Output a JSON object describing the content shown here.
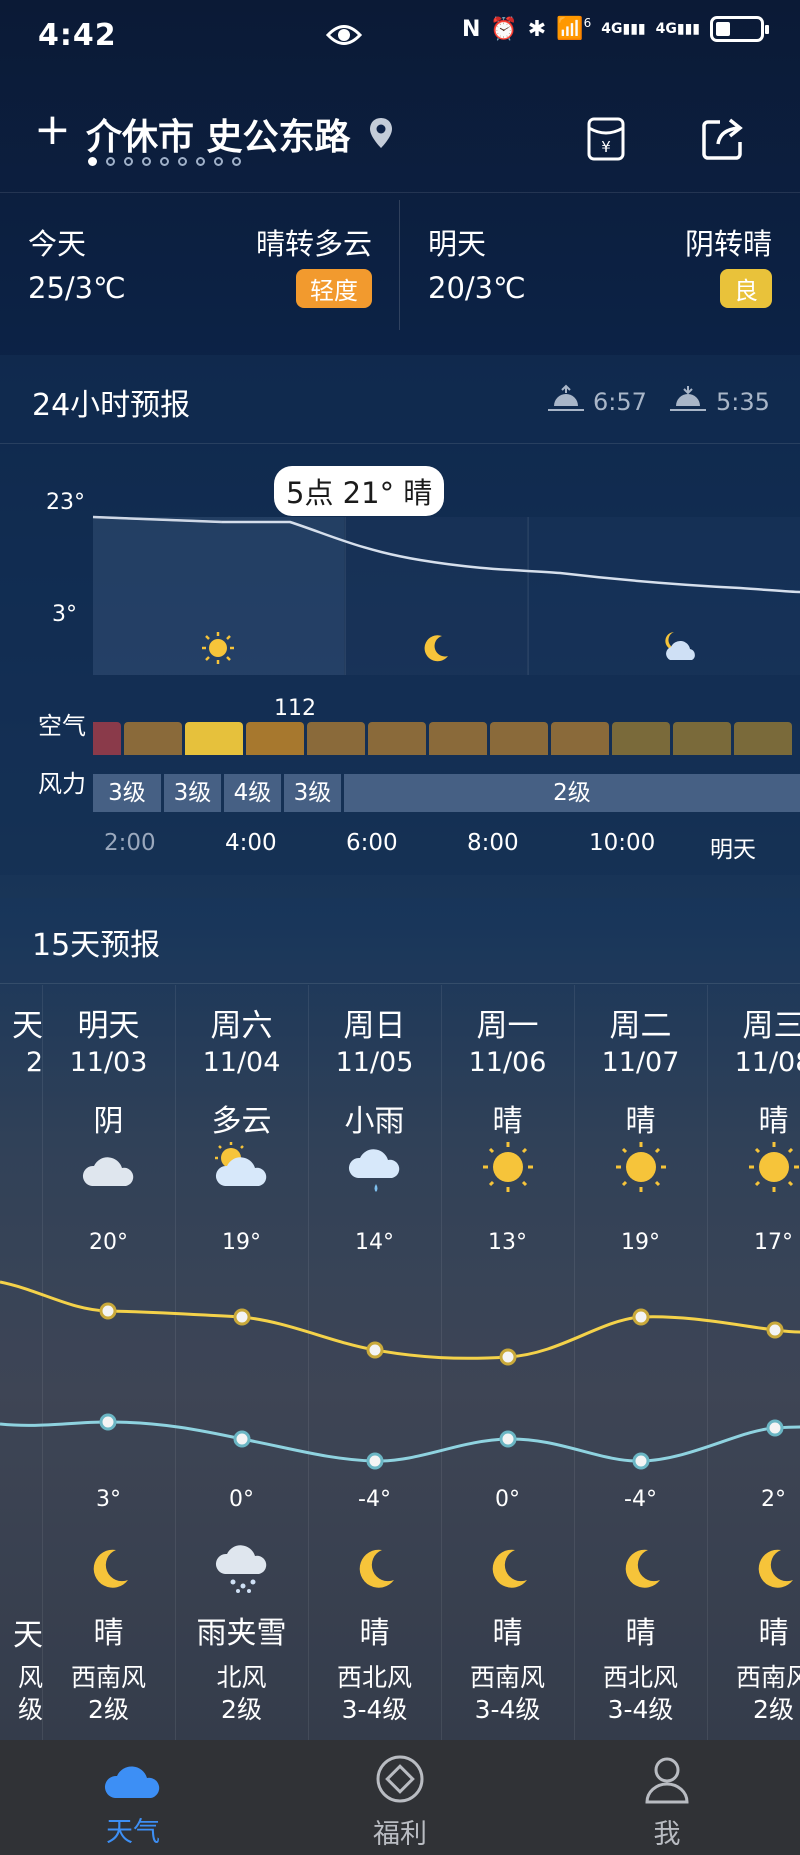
{
  "status_bar": {
    "time": "4:42",
    "net1": "4G",
    "net2": "4G",
    "wifi_badge": "6"
  },
  "header": {
    "add_label": "+",
    "location": "介休市 史公东路",
    "page_count": 9,
    "active_page": 0
  },
  "summary": {
    "today": {
      "label": "今天",
      "temp": "25/3℃",
      "condition": "晴转多云",
      "aq": "轻度",
      "aq_color": "#f29a2e"
    },
    "tomorrow": {
      "label": "明天",
      "temp": "20/3℃",
      "condition": "阴转晴",
      "aq": "良",
      "aq_color": "#e9c23a"
    }
  },
  "forecast_24h": {
    "title": "24小时预报",
    "sunrise": "6:57",
    "sunset": "5:35",
    "y_max_label": "23°",
    "y_min_label": "3°",
    "tooltip": "5点 21° 晴",
    "air_label": "空气",
    "air_value_label": "112",
    "wind_label": "风力",
    "wind_cells": [
      "3级",
      "3级",
      "4级",
      "3级",
      "2级"
    ],
    "time_labels": [
      "2:00",
      "4:00",
      "6:00",
      "8:00",
      "10:00",
      "明天"
    ],
    "aqi_colors": [
      "#8a3a4a",
      "#8a6a3a",
      "#e6c13c",
      "#a7782e",
      "#8a6a3a",
      "#8a6a3a",
      "#8a6a3a",
      "#8a6a3a",
      "#8a6a3a",
      "#7a6a3a",
      "#7a6a3a",
      "#7a6a3a"
    ]
  },
  "forecast_15d": {
    "title": "15天预报",
    "days": [
      {
        "name": "天",
        "date": "2",
        "day_cond": "",
        "high": "",
        "low": "",
        "night_cond": "天",
        "wind_dir": "风",
        "wind_level": "级"
      },
      {
        "name": "明天",
        "date": "11/03",
        "day_cond": "阴",
        "high": "20°",
        "low": "3°",
        "night_cond": "晴",
        "wind_dir": "西南风",
        "wind_level": "2级"
      },
      {
        "name": "周六",
        "date": "11/04",
        "day_cond": "多云",
        "high": "19°",
        "low": "0°",
        "night_cond": "雨夹雪",
        "wind_dir": "北风",
        "wind_level": "2级"
      },
      {
        "name": "周日",
        "date": "11/05",
        "day_cond": "小雨",
        "high": "14°",
        "low": "-4°",
        "night_cond": "晴",
        "wind_dir": "西北风",
        "wind_level": "3-4级"
      },
      {
        "name": "周一",
        "date": "11/06",
        "day_cond": "晴",
        "high": "13°",
        "low": "0°",
        "night_cond": "晴",
        "wind_dir": "西南风",
        "wind_level": "3-4级"
      },
      {
        "name": "周二",
        "date": "11/07",
        "day_cond": "晴",
        "high": "19°",
        "low": "-4°",
        "night_cond": "晴",
        "wind_dir": "西北风",
        "wind_level": "3-4级"
      },
      {
        "name": "周三",
        "date": "11/08",
        "day_cond": "晴",
        "high": "17°",
        "low": "2°",
        "night_cond": "晴",
        "wind_dir": "西南风",
        "wind_level": "2级"
      }
    ]
  },
  "bottom_nav": [
    {
      "label": "天气",
      "color": "#3d8ff5"
    },
    {
      "label": "福利",
      "color": "#b9bcc2"
    },
    {
      "label": "我",
      "color": "#b9bcc2"
    }
  ]
}
